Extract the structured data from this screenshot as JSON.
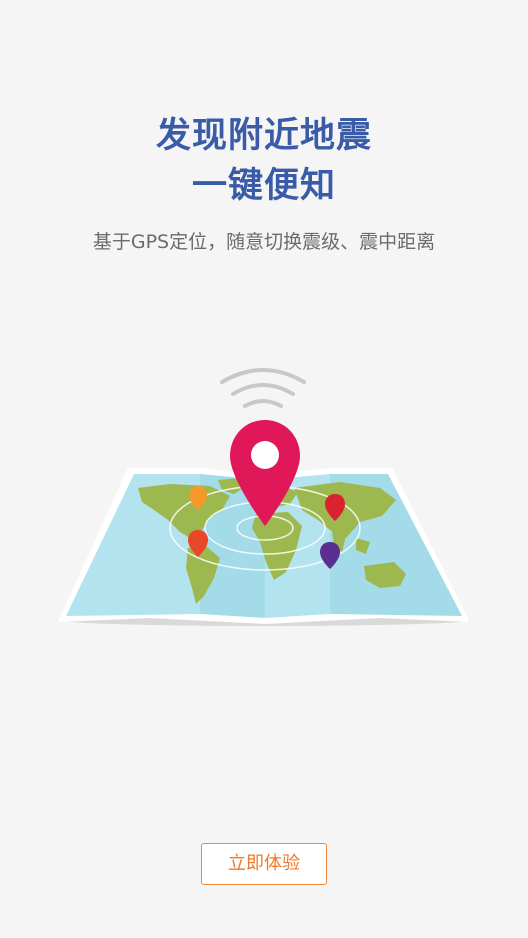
{
  "intro": {
    "headline_line1": "发现附近地震",
    "headline_line2": "一键便知",
    "subtitle": "基于GPS定位，随意切换震级、震中距离"
  },
  "illustration": {
    "icon": "world-map-with-location-pin",
    "colors": {
      "ocean": "#b2e3ef",
      "land": "#9db84e",
      "main_pin": "#e0185a",
      "signal": "#c8c8c8"
    },
    "small_pins": [
      {
        "icon": "orange-pin-icon",
        "color": "#f59a2a"
      },
      {
        "icon": "red-pin-icon",
        "color": "#e8472a"
      },
      {
        "icon": "crimson-pin-icon",
        "color": "#d9232e"
      },
      {
        "icon": "purple-pin-icon",
        "color": "#5b2f91"
      }
    ]
  },
  "cta": {
    "label": "立即体验",
    "accent": "#ee7a2c"
  }
}
